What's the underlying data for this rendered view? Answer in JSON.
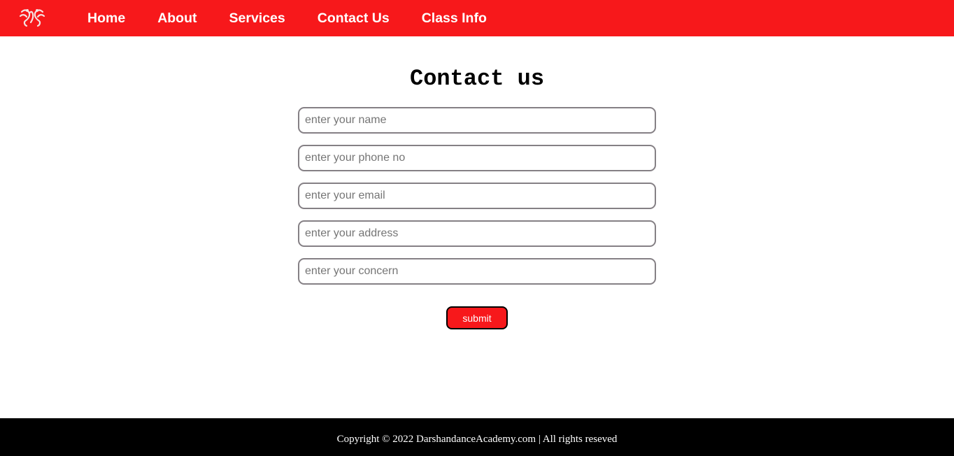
{
  "nav": {
    "logo_icon": "dancers-logo-icon",
    "items": [
      {
        "label": "Home"
      },
      {
        "label": "About"
      },
      {
        "label": "Services"
      },
      {
        "label": "Contact Us"
      },
      {
        "label": "Class Info"
      }
    ]
  },
  "contact": {
    "title": "Contact us",
    "fields": {
      "name": {
        "placeholder": "enter your name",
        "value": ""
      },
      "phone": {
        "placeholder": "enter your phone no",
        "value": ""
      },
      "email": {
        "placeholder": "enter your email",
        "value": ""
      },
      "address": {
        "placeholder": "enter your address",
        "value": ""
      },
      "concern": {
        "placeholder": "enter your concern",
        "value": ""
      }
    },
    "submit_label": "submit"
  },
  "footer": {
    "text": "Copyright © 2022 DarshandanceAcademy.com | All rights reseved"
  },
  "colors": {
    "brand_red": "#f7181b",
    "footer_bg": "#000000",
    "field_border": "#858085"
  }
}
